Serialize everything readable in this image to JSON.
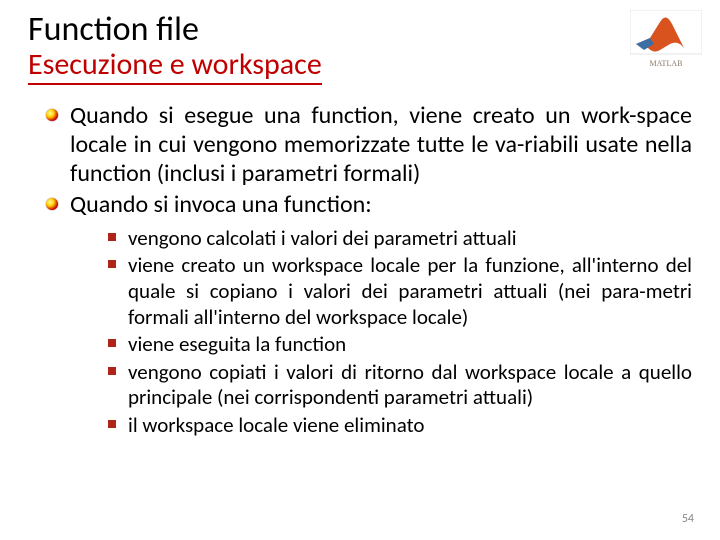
{
  "header": {
    "title": "Function file",
    "subtitle": "Esecuzione e workspace",
    "logo_alt": "MATLAB"
  },
  "bullets": {
    "level1": [
      "Quando si esegue una function, viene creato un work-space locale in cui vengono memorizzate tutte le va-riabili usate nella function (inclusi i parametri formali)",
      "Quando si invoca una function:"
    ],
    "level2": [
      "vengono calcolati i valori dei parametri attuali",
      "viene creato un workspace locale per la funzione, all'interno del quale si copiano i valori dei parametri attuali (nei para-metri formali all'interno del workspace locale)",
      "viene eseguita la function",
      "vengono copiati i valori di ritorno dal workspace locale a quello principale (nei corrispondenti parametri attuali)",
      "il workspace locale viene eliminato"
    ]
  },
  "page_number": "54"
}
